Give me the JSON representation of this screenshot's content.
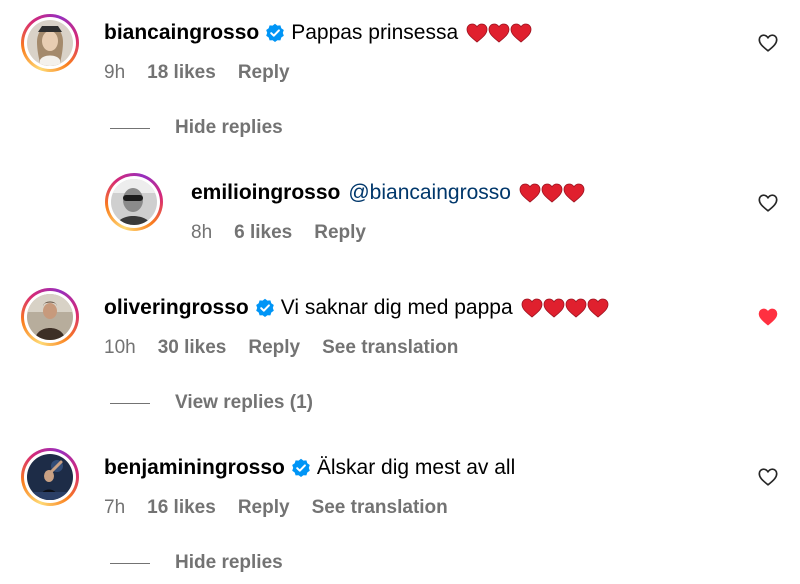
{
  "comments": [
    {
      "username": "biancaingrosso",
      "verified": true,
      "text": "Pappas prinsessa",
      "hearts": 3,
      "time": "9h",
      "likes": "18 likes",
      "reply": "Reply",
      "replies_toggle": "Hide replies",
      "liked": false
    },
    {
      "username": "emilioingrosso",
      "verified": false,
      "mention": "@biancaingrosso",
      "hearts": 3,
      "time": "8h",
      "likes": "6 likes",
      "reply": "Reply",
      "liked": false
    },
    {
      "username": "oliveringrosso",
      "verified": true,
      "text": "Vi saknar dig med pappa",
      "hearts": 4,
      "time": "10h",
      "likes": "30 likes",
      "reply": "Reply",
      "translation": "See translation",
      "replies_toggle": "View replies (1)",
      "liked": true
    },
    {
      "username": "benjaminingrosso",
      "verified": true,
      "text": "Älskar dig mest av all",
      "time": "7h",
      "likes": "16 likes",
      "reply": "Reply",
      "translation": "See translation",
      "replies_toggle": "Hide replies",
      "liked": false
    }
  ],
  "colors": {
    "verified_badge": "#0095f6",
    "liked_heart": "#ff3040",
    "emoji_heart": "#e0202e",
    "meta_text": "#737373",
    "mention": "#00376b"
  },
  "icons": [
    "verified-badge-icon",
    "heart-outline-icon",
    "heart-filled-icon",
    "red-heart-emoji-icon"
  ]
}
